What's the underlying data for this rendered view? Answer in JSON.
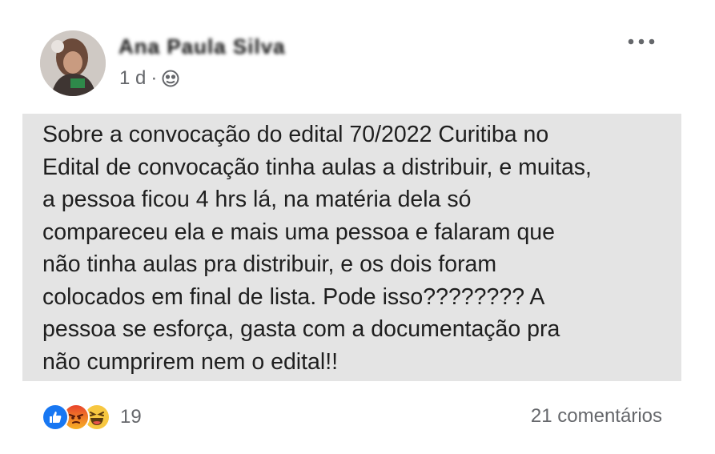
{
  "post": {
    "author_name": "Ana Paula Silva",
    "time": "1 d",
    "separator": "·",
    "audience_icon": "globe-icon",
    "more_icon": "more-horizontal-icon",
    "text_lines": [
      "Sobre a convocação do edital 70/2022 Curitiba no",
      "Edital de convocação tinha aulas a distribuir, e muitas,",
      "a pessoa ficou 4 hrs lá, na matéria dela só",
      "compareceu ela e mais uma pessoa e falaram que",
      "não tinha aulas pra distribuir, e os dois foram",
      "colocados em final de lista. Pode isso???????? A",
      "pessoa se esforça, gasta com a documentação pra",
      "não cumprirem nem o edital!!"
    ],
    "text_background": "#e4e4e4"
  },
  "footer": {
    "reactions": [
      "like-icon",
      "angry-icon",
      "haha-icon"
    ],
    "reaction_count": "19",
    "comments_label": "21 comentários"
  },
  "colors": {
    "like": "#1877f2",
    "angry": "#f0652a",
    "haha": "#f7c740",
    "secondary_text": "#65676b"
  }
}
